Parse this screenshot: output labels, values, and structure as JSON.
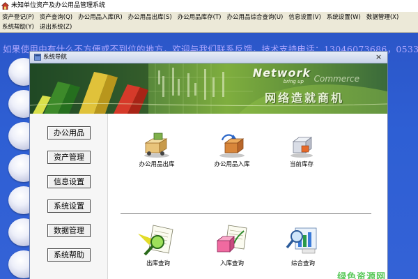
{
  "window": {
    "title": "未知单位资产及办公用品管理系统"
  },
  "menu": {
    "row1": [
      "资产登记(P)",
      "资产查询(Q)",
      "办公用品入库(R)",
      "办公用品出库(S)",
      "办公用品库存(T)",
      "办公用品综合查询(U)",
      "信息设置(V)",
      "系统设置(W)",
      "数据管理(X)"
    ],
    "row2": [
      "系统帮助(Y)",
      "退出系统(Z)"
    ]
  },
  "marquee": {
    "text": "如果使用中有什么不方便或不到位的地方，欢迎与我们联系反馈，技术支持电话：13046073686，0533"
  },
  "nav_window": {
    "title": "系统导航",
    "close": "×",
    "banner": {
      "logo": "Network",
      "sub": "bring up",
      "sub2": "Commerce",
      "slogan": "网络造就商机"
    },
    "sidebar": [
      "办公用品",
      "资产管理",
      "信息设置",
      "系统设置",
      "数据管理",
      "系统帮助"
    ],
    "functions_top": [
      {
        "label": "办公用品出库",
        "icon": "truck-outbound-icon"
      },
      {
        "label": "办公用品入库",
        "icon": "boxes-inbound-icon"
      },
      {
        "label": "当前库存",
        "icon": "inventory-box-icon"
      }
    ],
    "functions_bottom": [
      {
        "label": "出库查询",
        "icon": "magnifier-document-icon"
      },
      {
        "label": "入库查询",
        "icon": "box-document-icon"
      },
      {
        "label": "综合查询",
        "icon": "chart-search-icon"
      }
    ]
  },
  "watermark": "绿色资源网",
  "colors": {
    "desktop": "#2e5fd4",
    "marquee_text": "#b0a8ff",
    "watermark": "#3dbf3d"
  }
}
